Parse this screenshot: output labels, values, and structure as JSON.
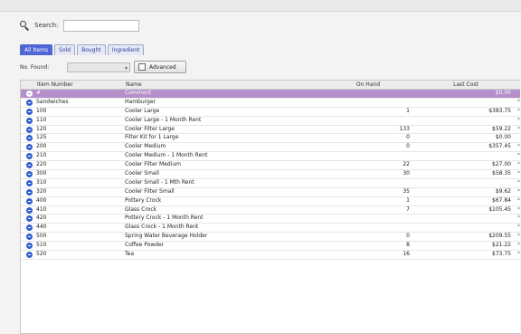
{
  "search": {
    "label": "Search:",
    "placeholder": "",
    "value": ""
  },
  "tabs": [
    {
      "label": "All Items",
      "active": true
    },
    {
      "label": "Sold"
    },
    {
      "label": "Bought"
    },
    {
      "label": "Ingredient"
    }
  ],
  "toolbar": {
    "found_label": "No. Found:",
    "found_value": "",
    "advanced_label": "Advanced"
  },
  "columns": {
    "item_number": "Item Number",
    "name": "Name",
    "on_hand": "On Hand",
    "last_cost": "Last Cost"
  },
  "rows": [
    {
      "item": "#",
      "name": "Comment",
      "on_hand": "",
      "cost": "$0.00",
      "flag": "",
      "selected": true
    },
    {
      "item": "Sandwiches",
      "name": "Hamburger",
      "on_hand": "",
      "cost": "",
      "flag": "*"
    },
    {
      "item": "100",
      "name": "Cooler Large",
      "on_hand": "1",
      "cost": "$383.75",
      "flag": "*"
    },
    {
      "item": "110",
      "name": "Cooler Large - 1 Month Rent",
      "on_hand": "",
      "cost": "",
      "flag": "*"
    },
    {
      "item": "120",
      "name": "Cooler Filter Large",
      "on_hand": "133",
      "cost": "$59.22",
      "flag": "*"
    },
    {
      "item": "125",
      "name": "Filter Kit for 1 Large",
      "on_hand": "0",
      "cost": "$0.00",
      "flag": ""
    },
    {
      "item": "200",
      "name": "Cooler Medium",
      "on_hand": "0",
      "cost": "$357.45",
      "flag": "*"
    },
    {
      "item": "210",
      "name": "Cooler Medium - 1 Month Rent",
      "on_hand": "",
      "cost": "",
      "flag": "*"
    },
    {
      "item": "220",
      "name": "Cooler Filter Medium",
      "on_hand": "22",
      "cost": "$27.00",
      "flag": "*"
    },
    {
      "item": "300",
      "name": "Cooler Small",
      "on_hand": "30",
      "cost": "$58.35",
      "flag": "*"
    },
    {
      "item": "310",
      "name": "Cooler Small - 1 Mth Rent",
      "on_hand": "",
      "cost": "",
      "flag": "*"
    },
    {
      "item": "320",
      "name": "Cooler Filter Small",
      "on_hand": "35",
      "cost": "$9.62",
      "flag": "*"
    },
    {
      "item": "400",
      "name": "Pottery Crock",
      "on_hand": "1",
      "cost": "$67.84",
      "flag": "*"
    },
    {
      "item": "410",
      "name": "Glass Crock",
      "on_hand": "7",
      "cost": "$105.45",
      "flag": "*"
    },
    {
      "item": "420",
      "name": "Pottery Crock - 1 Month Rent",
      "on_hand": "",
      "cost": "",
      "flag": "*"
    },
    {
      "item": "440",
      "name": "Glass Crock - 1 Month Rent",
      "on_hand": "",
      "cost": "",
      "flag": "*"
    },
    {
      "item": "500",
      "name": "Spring Water Beverage Holder",
      "on_hand": "0",
      "cost": "$209.55",
      "flag": "*"
    },
    {
      "item": "510",
      "name": "Coffee Powder",
      "on_hand": "8",
      "cost": "$21.22",
      "flag": "*"
    },
    {
      "item": "520",
      "name": "Tea",
      "on_hand": "16",
      "cost": "$73.75",
      "flag": "*"
    }
  ]
}
